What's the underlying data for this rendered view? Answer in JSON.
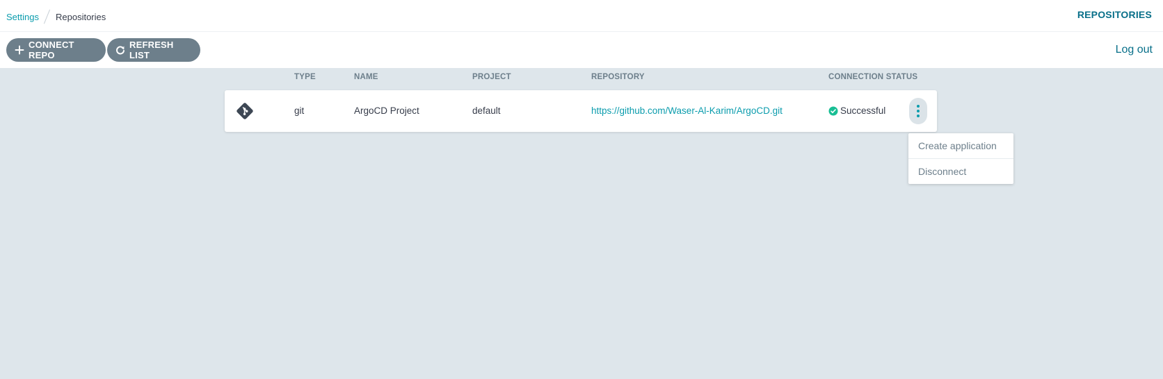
{
  "breadcrumb": {
    "parent": "Settings",
    "current": "Repositories"
  },
  "page_title": "REPOSITORIES",
  "toolbar": {
    "connect_label": "CONNECT REPO",
    "refresh_label": "REFRESH LIST",
    "logout_label": "Log out"
  },
  "table": {
    "headers": {
      "type": "TYPE",
      "name": "NAME",
      "project": "PROJECT",
      "repository": "REPOSITORY",
      "status": "CONNECTION STATUS"
    },
    "rows": [
      {
        "icon": "git-icon",
        "type": "git",
        "name": "ArgoCD Project",
        "project": "default",
        "repository": "https://github.com/Waser-Al-Karim/ArgoCD.git",
        "status": "Successful"
      }
    ]
  },
  "dropdown": {
    "items": [
      "Create application",
      "Disconnect"
    ]
  },
  "colors": {
    "accent": "#0b9cad",
    "title": "#086f89",
    "button": "#6d7f8b",
    "success": "#18be94",
    "background": "#dee6eb"
  }
}
